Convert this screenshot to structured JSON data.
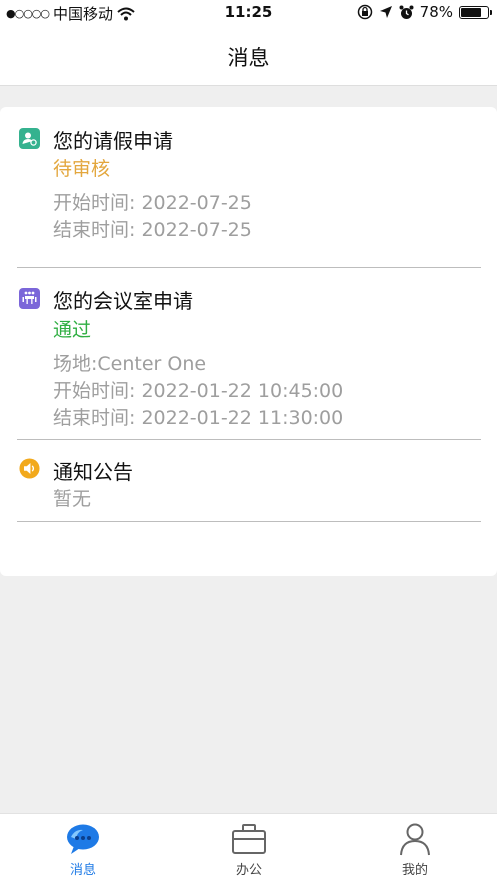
{
  "status_bar": {
    "carrier": "中国移动",
    "time": "11:25",
    "battery": "78%",
    "battery_level": 0.78
  },
  "header": {
    "title": "消息"
  },
  "messages": [
    {
      "icon": "person-badge-icon",
      "title": "您的请假申请",
      "status": "待审核",
      "status_color": "#e3a73e",
      "details": [
        "开始时间: 2022-07-25",
        "结束时间: 2022-07-25"
      ]
    },
    {
      "icon": "meeting-room-icon",
      "title": "您的会议室申请",
      "status": "通过",
      "status_color": "#2fae42",
      "details": [
        "场地:Center One",
        "开始时间: 2022-01-22 10:45:00",
        "结束时间: 2022-01-22 11:30:00"
      ]
    },
    {
      "icon": "speaker-icon",
      "title": "通知公告",
      "details": [
        "暂无"
      ]
    }
  ],
  "tabs": [
    {
      "label": "消息",
      "icon": "chat-bubble-icon",
      "active": true
    },
    {
      "label": "办公",
      "icon": "briefcase-icon",
      "active": false
    },
    {
      "label": "我的",
      "icon": "person-icon",
      "active": false
    }
  ],
  "colors": {
    "accent": "#1e7ae6",
    "leave_icon_bg": "#35b28f",
    "meeting_icon_bg": "#7b66d9",
    "notice_icon_bg": "#f2a91c"
  }
}
